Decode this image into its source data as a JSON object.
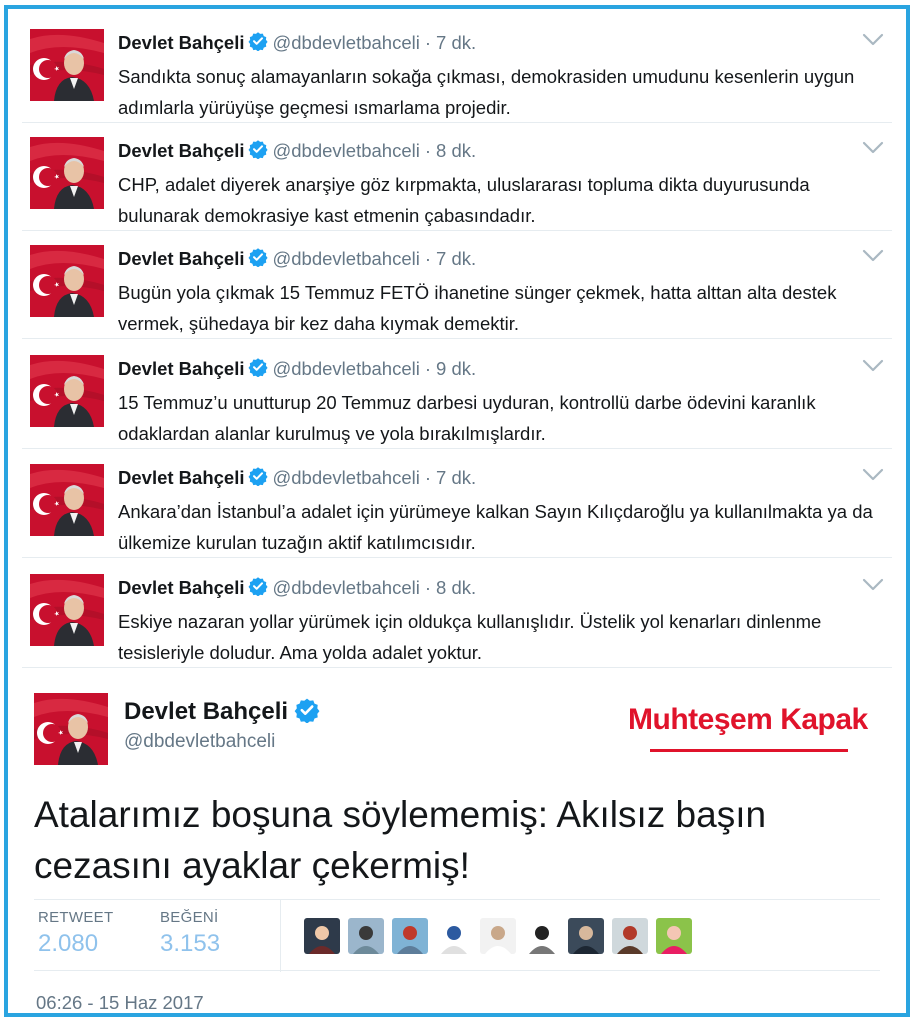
{
  "author": {
    "name": "Devlet Bahçeli",
    "handle": "@dbdevletbahceli"
  },
  "tweets": [
    {
      "time": "7 dk.",
      "text": "Sandıkta sonuç alamayanların sokağa çıkması, demokrasiden umudunu kesenlerin uygun adımlarla yürüyüşe geçmesi ısmarlama projedir."
    },
    {
      "time": "8 dk.",
      "text": "CHP, adalet diyerek anarşiye göz kırpmakta, uluslararası topluma dikta duyurusunda bulunarak demokrasiye kast etmenin çabasındadır."
    },
    {
      "time": "7 dk.",
      "text": "Bugün yola çıkmak 15 Temmuz FETÖ ihanetine sünger çekmek, hatta alttan alta destek vermek, şühedaya bir kez daha kıymak demektir."
    },
    {
      "time": "9 dk.",
      "text": "15 Temmuz’u unutturup 20 Temmuz darbesi uyduran, kontrollü darbe ödevini karanlık odaklardan alanlar kurulmuş ve yola bırakılmışlardır."
    },
    {
      "time": "7 dk.",
      "text": "Ankara’dan İstanbul’a adalet için yürümeye kalkan Sayın Kılıçdaroğlu ya kullanılmakta ya da ülkemize kurulan tuzağın aktif katılımcısıdır."
    },
    {
      "time": "8 dk.",
      "text": "Eskiye nazaran yollar yürümek için oldukça kullanışlıdır. Üstelik yol kenarları dinlenme tesisleriyle doludur. Ama yolda adalet yoktur."
    }
  ],
  "main_tweet": {
    "text": "Atalarımız boşuna söylememiş: Akılsız başın cezasını ayaklar çekermiş!",
    "stamp": "Muhteşem Kapak",
    "retweet_label": "RETWEET",
    "retweet_count": "2.080",
    "like_label": "BEĞENİ",
    "like_count": "3.153",
    "date": "06:26 - 15 Haz 2017",
    "liker_count": 9
  },
  "icons": {
    "verified": "verified-badge-icon",
    "chevron": "chevron-down-icon",
    "separator": "·"
  },
  "colors": {
    "frame": "#2aa4e0",
    "verified": "#1da1f2",
    "stamp": "#e0132b",
    "stat_value": "#8fc2ec",
    "muted": "#657786"
  }
}
